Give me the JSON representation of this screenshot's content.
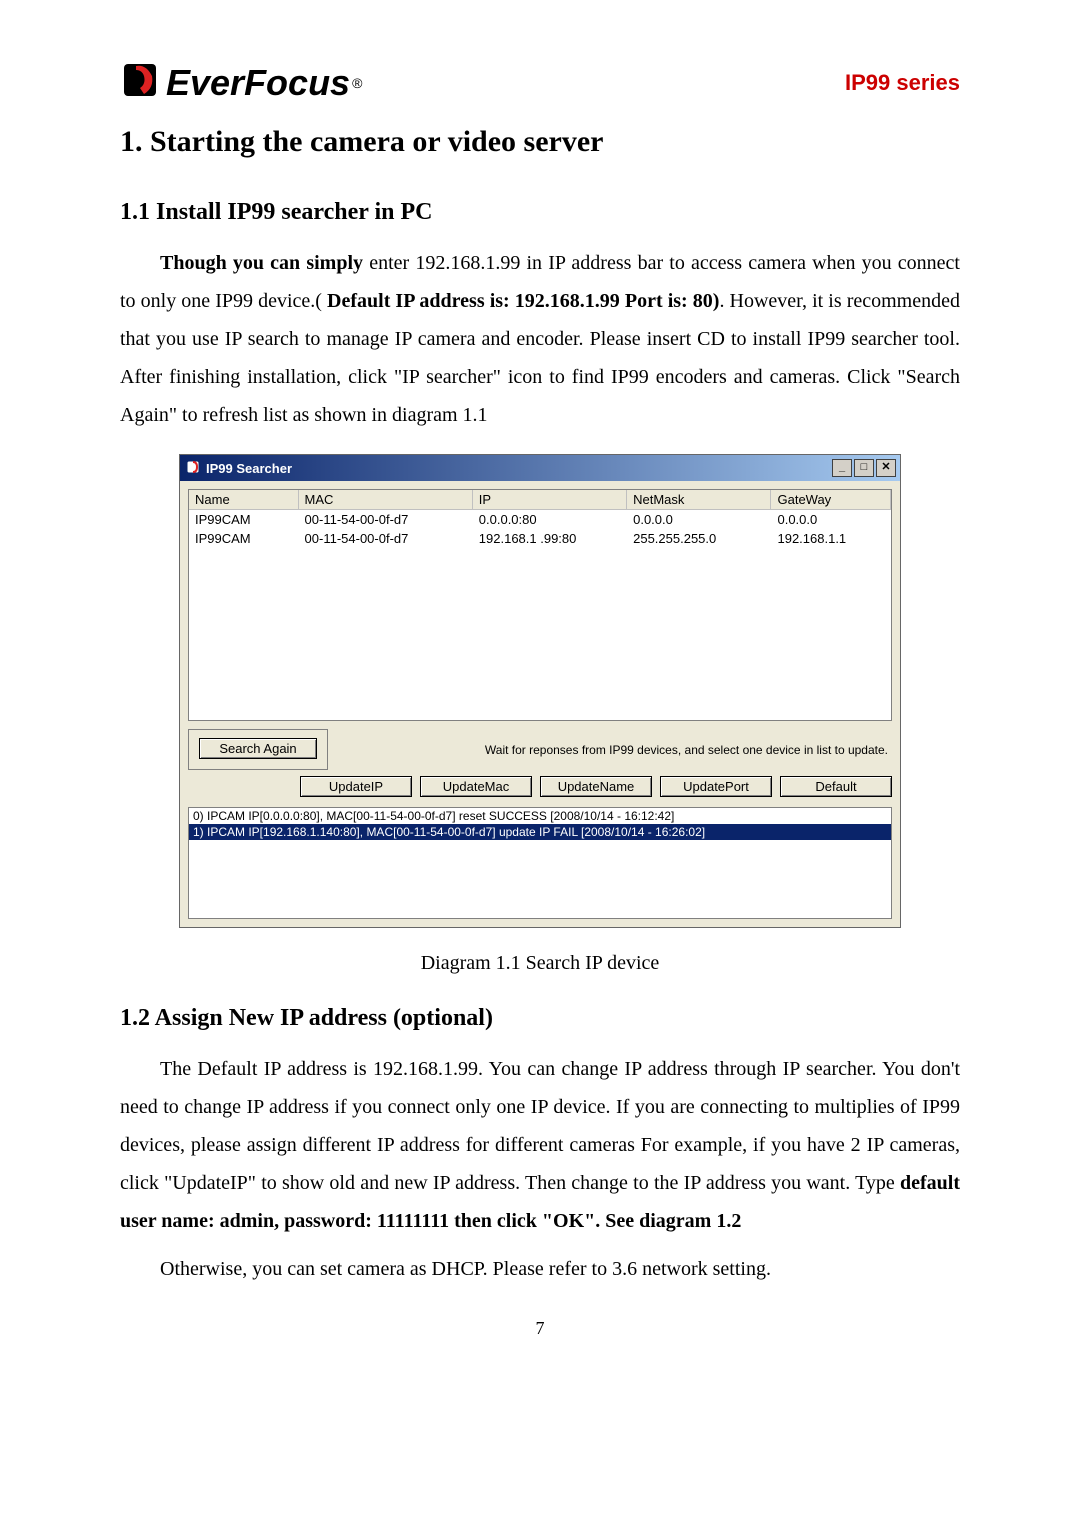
{
  "header": {
    "logo_text": "EverFocus",
    "registered": "®",
    "series": "IP99 series"
  },
  "section": {
    "h1": "1. Starting the camera or video server",
    "h2_1": "1.1 Install IP99 searcher in PC",
    "p1_part1": "Though you can simply ",
    "p1_part2": "enter 192.168.1.99 in IP address bar to access camera when you connect to only one IP99 device.( ",
    "p1_bold2": "Default IP address is: 192.168.1.99 Port is: 80)",
    "p1_part3": ". However, it is recommended that you use IP search to manage IP camera and encoder. Please insert CD to install IP99 searcher tool. After finishing installation, click \"IP searcher\" icon to find IP99 encoders and cameras. Click \"Search Again\" to refresh list as shown in diagram 1.1",
    "diagram_caption": "Diagram 1.1 Search IP device",
    "h2_2": "1.2 Assign New IP address (optional)",
    "p2_part1": "The Default IP address is 192.168.1.99. You can change IP address through IP searcher. You don't need to change IP address if you connect only one IP device. If you are connecting to multiplies of IP99 devices, please assign different IP address for different cameras For example, if you have 2 IP cameras, click \"UpdateIP\" to show old and new IP address. Then change to the IP address you want. Type ",
    "p2_bold": "default user name: admin, password: 11111111 then click \"OK\". See diagram 1.2",
    "p3": "Otherwise, you can set camera as DHCP. Please refer to 3.6 network setting.",
    "page_number": "7"
  },
  "dialog": {
    "title": "IP99 Searcher",
    "min": "_",
    "max": "□",
    "close": "✕",
    "columns": {
      "name": "Name",
      "mac": "MAC",
      "ip": "IP",
      "mask": "NetMask",
      "gw": "GateWay"
    },
    "rows": [
      {
        "name": "IP99CAM",
        "mac": "00-11-54-00-0f-d7",
        "ip": "0.0.0.0:80",
        "mask": "0.0.0.0",
        "gw": "0.0.0.0"
      },
      {
        "name": "IP99CAM",
        "mac": "00-11-54-00-0f-d7",
        "ip": "192.168.1 .99:80",
        "mask": "255.255.255.0",
        "gw": "192.168.1.1"
      }
    ],
    "hint": "Wait for reponses from IP99 devices, and select one device in list to update.",
    "buttons": {
      "search": "Search Again",
      "update_ip": "UpdateIP",
      "update_mac": "UpdateMac",
      "update_name": "UpdateName",
      "update_port": "UpdatePort",
      "default": "Default"
    },
    "log": [
      "0)   IPCAM IP[0.0.0.0:80], MAC[00-11-54-00-0f-d7] reset SUCCESS        [2008/10/14 - 16:12:42]",
      "1)   IPCAM IP[192.168.1.140:80], MAC[00-11-54-00-0f-d7] update IP FAIL        [2008/10/14 - 16:26:02]"
    ]
  }
}
